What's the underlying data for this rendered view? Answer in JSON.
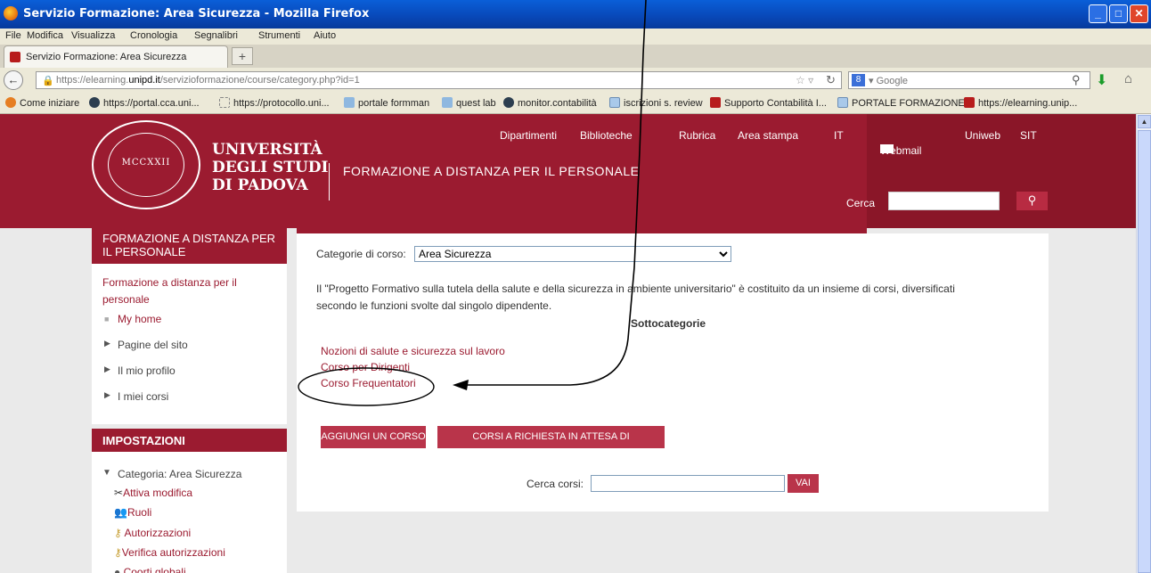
{
  "window": {
    "title": "Servizio Formazione: Area Sicurezza - Mozilla Firefox"
  },
  "menu": [
    "File",
    "Modifica",
    "Visualizza",
    "Cronologia",
    "Segnalibri",
    "Strumenti",
    "Aiuto"
  ],
  "tab": {
    "label": "Servizio Formazione: Area Sicurezza",
    "new_tab": "+"
  },
  "nav": {
    "url_prefix": "https://elearning.",
    "url_domain": "unipd.it",
    "url_suffix": "/servizioformazione/course/category.php?id=1",
    "search_engine": "Google"
  },
  "bookmarks": [
    "Come iniziare",
    "https://portal.cca.uni...",
    "https://protocollo.uni...",
    "portale formman",
    "quest lab",
    "monitor.contabilità",
    "iscrizioni s. review",
    "Supporto Contabilità I...",
    "PORTALE FORMAZIONE",
    "https://elearning.unip..."
  ],
  "header": {
    "seal_text": "MCCXXII",
    "uni_line1": "UNIVERSITÀ",
    "uni_line2": "DEGLI STUDI",
    "uni_line3": "DI PADOVA",
    "site_title": "FORMAZIONE A DISTANZA PER IL PERSONALE",
    "links": [
      "Dipartimenti",
      "Biblioteche",
      "Rubrica",
      "Area stampa",
      "IT",
      "Webmail",
      "Uniweb",
      "SIT"
    ],
    "search_label": "Cerca",
    "search_icon": "magnifier"
  },
  "nav_block": {
    "title": "FORMAZIONE A DISTANZA PER IL PERSONALE",
    "root_link_line1": "Formazione a distanza per il",
    "root_link_line2": "personale",
    "my_home": "My home",
    "items": [
      "Pagine del sito",
      "Il mio profilo",
      "I miei corsi"
    ]
  },
  "settings_block": {
    "title": "IMPOSTAZIONI",
    "category": "Categoria: Area Sicurezza",
    "items": [
      "Attiva modifica",
      "Ruoli",
      "Autorizzazioni",
      "Verifica autorizzazioni",
      "Coorti globali"
    ]
  },
  "main": {
    "category_label": "Categorie di corso:",
    "category_value": "Area Sicurezza",
    "description_line1": "Il \"Progetto Formativo sulla tutela della salute e della sicurezza in ambiente universitario\" è costituito da un insieme di corsi, diversificati",
    "description_line2": "secondo le funzioni svolte dal singolo dipendente.",
    "subcategories_heading": "Sottocategorie",
    "subcategories": [
      "Nozioni di salute e sicurezza sul lavoro",
      "Corso per Dirigenti",
      "Corso Frequentatori"
    ],
    "add_course_btn": "AGGIUNGI UN CORSO",
    "pending_btn": "CORSI A RICHIESTA IN ATTESA DI APPROVAZIONE",
    "search_courses_label": "Cerca corsi:",
    "go_btn": "VAI"
  },
  "colors": {
    "brand": "#9b1b30",
    "brand_dark": "#8a1628",
    "button": "#b9344a"
  }
}
